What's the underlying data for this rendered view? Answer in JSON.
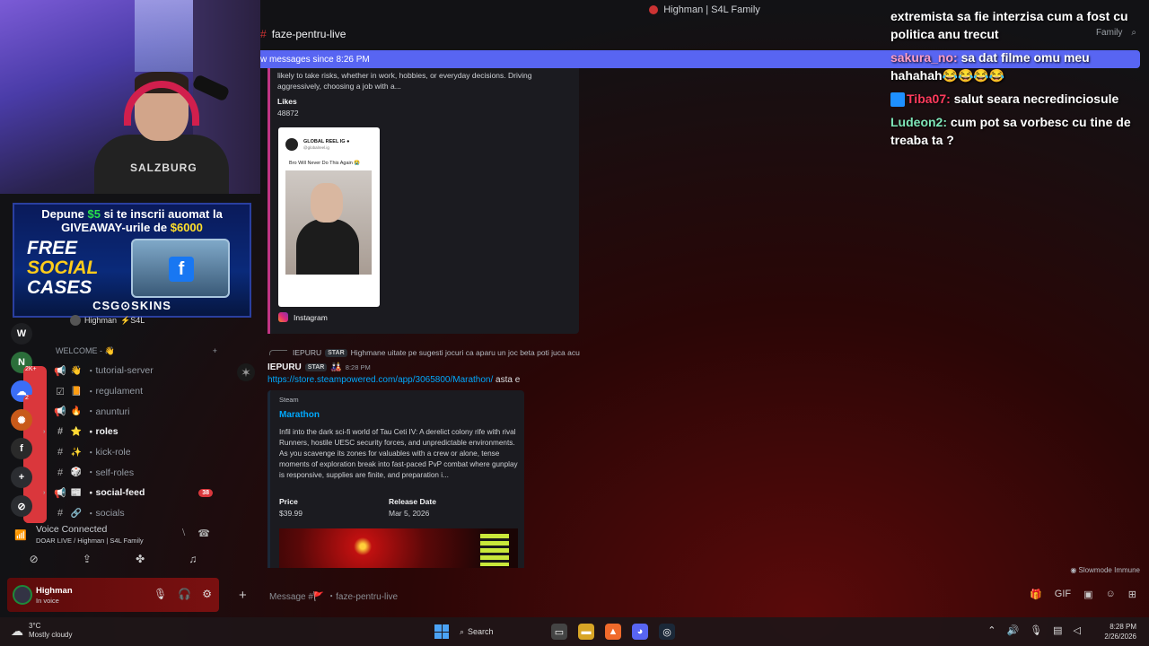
{
  "window": {
    "title": "Highman | S4L Family"
  },
  "channel_header": {
    "name": "faze-pentru-live",
    "search_placeholder": "Family"
  },
  "new_messages_bar": {
    "text": "w messages since 8:26 PM"
  },
  "webcam": {
    "shirt_text": "SALZBURG"
  },
  "ad": {
    "line1_prefix": "Depune ",
    "line1_amount": "$5",
    "line1_suffix": " si te inscrii auomat la",
    "line2_prefix": "GIVEAWAY-urile de ",
    "line2_amount": "$6000",
    "free1": "FREE",
    "free2": "SOCIAL",
    "free3": "CASES",
    "case_logo": "f",
    "brand": "CSG⊙SKINS"
  },
  "server_rail": [
    {
      "letter": "W",
      "color": "#1e1f22",
      "badge": ""
    },
    {
      "letter": "N",
      "color": "#2b6e3a",
      "badge": "2K+"
    },
    {
      "letter": "☁",
      "color": "#3b6ef5",
      "badge": "2"
    },
    {
      "letter": "✺",
      "color": "#c85a1a",
      "badge": ""
    },
    {
      "letter": "f",
      "color": "#2a2a2a",
      "badge": ""
    },
    {
      "letter": "+",
      "color": "#2b2d31",
      "badge": ""
    },
    {
      "letter": "⊘",
      "color": "#2b2d31",
      "badge": ""
    }
  ],
  "server_user": {
    "name": "Highman",
    "tag": "⚡S4L"
  },
  "category": {
    "name": "WELCOME - 👋",
    "add": "+"
  },
  "channels": [
    {
      "type": "announce",
      "emoji": "👋",
      "name": "tutorial-server",
      "bold": false,
      "arrow": "",
      "badge": ""
    },
    {
      "type": "rules",
      "emoji": "📙",
      "name": "regulament",
      "bold": false,
      "arrow": "",
      "badge": ""
    },
    {
      "type": "announce",
      "emoji": "🔥",
      "name": "anunturi",
      "bold": false,
      "arrow": "",
      "badge": ""
    },
    {
      "type": "text",
      "emoji": "⭐",
      "name": "roles",
      "bold": true,
      "arrow": "›",
      "badge": ""
    },
    {
      "type": "text",
      "emoji": "✨",
      "name": "kick-role",
      "bold": false,
      "arrow": "",
      "badge": ""
    },
    {
      "type": "text",
      "emoji": "🎲",
      "name": "self-roles",
      "bold": false,
      "arrow": "",
      "badge": ""
    },
    {
      "type": "announce",
      "emoji": "📰",
      "name": "social-feed",
      "bold": true,
      "arrow": "›",
      "badge": "38"
    },
    {
      "type": "text",
      "emoji": "🔗",
      "name": "socials",
      "bold": false,
      "arrow": "",
      "badge": ""
    }
  ],
  "voice": {
    "status": "Voice Connected",
    "location": "DOAR LIVE / Highman | S4L Family"
  },
  "user_panel": {
    "name": "Highman",
    "status": "In voice"
  },
  "embed_instagram": {
    "description": "likely to take risks, whether in work, hobbies, or everyday decisions. Driving aggressively, choosing a job with a...",
    "likes_label": "Likes",
    "likes_value": "48872",
    "card_account": "GLOBAL REEL IG ●",
    "card_handle": "@globalreel.ig",
    "card_caption": "Bro Will Never Do This Again 😭",
    "footer": "Instagram"
  },
  "reply": {
    "user": "IEPURU",
    "tag": "STAR",
    "text": "Highmane uitate pe sugesti jocuri ca aparu un joc beta poti juca acu"
  },
  "message2": {
    "user": "IEPURU",
    "tag": "STAR",
    "time": "8:28 PM",
    "link": "https://store.steampowered.com/app/3065800/Marathon/",
    "after_link": " asta e"
  },
  "embed_steam": {
    "provider": "Steam",
    "title": "Marathon",
    "description": "Infil into the dark sci-fi world of Tau Ceti IV: A derelict colony rife with rival Runners, hostile UESC security forces, and unpredictable environments. As you scavenge its zones for valuables with a crew or alone, tense moments of exploration break into fast-paced PvP combat where gunplay is responsive, supplies are finite, and preparation i...",
    "price_label": "Price",
    "price_value": "$39.99",
    "release_label": "Release Date",
    "release_value": "Mar 5, 2026"
  },
  "slowmode": "Slowmode Immune",
  "composer": {
    "placeholder": "Message #🚩 ・faze-pentru-live"
  },
  "chat_overlay": [
    {
      "user": "",
      "text": "extremista sa fie interzisa cum a fost cu politica anu trecut",
      "color": ""
    },
    {
      "user": "sakura_no:",
      "text": " sa dat filme omu meu hahahah😂😂😂😂",
      "color": "u1"
    },
    {
      "user": "Tiba07:",
      "text": " salut seara necredinciosule",
      "color": "u2"
    },
    {
      "user": "Ludeon2:",
      "text": " cum pot sa vorbesc cu tine de treaba ta ?",
      "color": "u3"
    }
  ],
  "taskbar": {
    "temp": "3°C",
    "weather": "Mostly cloudy",
    "search": "Search",
    "time": "8:28 PM",
    "date": "2/26/2026"
  }
}
